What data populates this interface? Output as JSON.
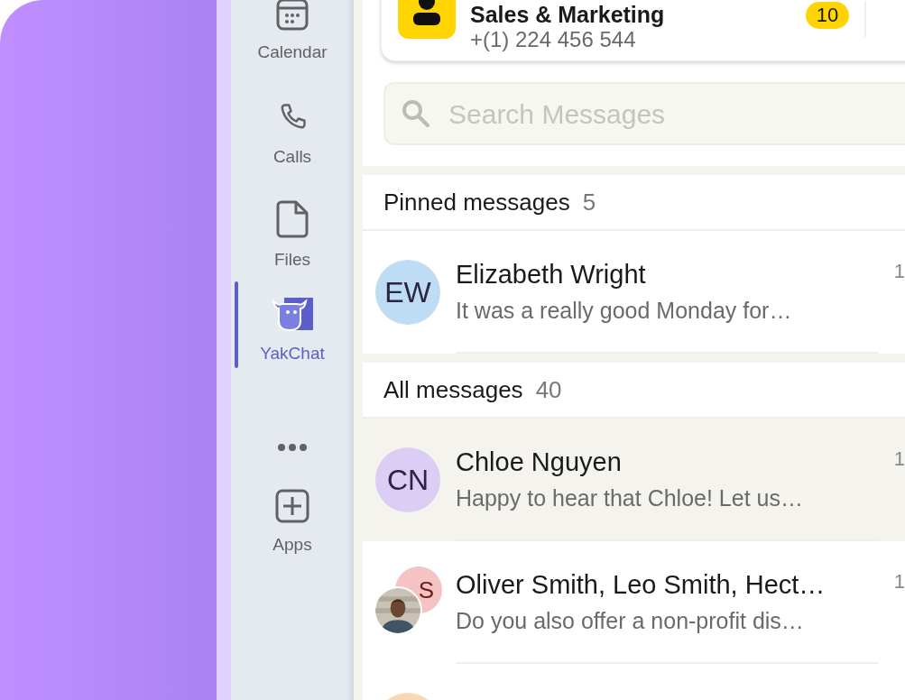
{
  "sidebar": {
    "items": [
      {
        "kind": "app",
        "label": "Calendar",
        "selected": false
      },
      {
        "kind": "app",
        "label": "Calls",
        "selected": false
      },
      {
        "kind": "app",
        "label": "Files",
        "selected": false
      },
      {
        "kind": "app",
        "label": "YakChat",
        "selected": true
      },
      {
        "kind": "more",
        "selected": false
      },
      {
        "kind": "app",
        "label": "Apps",
        "selected": false
      }
    ]
  },
  "contact_card": {
    "name": "Sales & Marketing",
    "phone": "+(1) 224 456 544",
    "badge": "10"
  },
  "search": {
    "placeholder": "Search Messages"
  },
  "sections": [
    {
      "title": "Pinned messages",
      "count": "5",
      "messages": [
        {
          "kind": "single",
          "name": "Elizabeth Wright",
          "preview": "It was a really good Monday for…",
          "initials": "EW",
          "color": "#bfdcf5",
          "time": "1",
          "selected": false
        }
      ]
    },
    {
      "title": "All messages",
      "count": "40",
      "messages": [
        {
          "kind": "single",
          "name": "Chloe Nguyen",
          "preview": "Happy to hear that Chloe! Let us…",
          "initials": "CN",
          "color": "#dccdf5",
          "time": "1",
          "selected": true
        },
        {
          "kind": "group",
          "name": "Oliver Smith, Leo Smith, Hect…",
          "preview": "Do you also offer a non-profit dis…",
          "initials": "S",
          "color": "#f6c3c3",
          "time": "1",
          "selected": false
        },
        {
          "kind": "single",
          "color": "#f9d8b4",
          "selected": false
        }
      ]
    }
  ]
}
